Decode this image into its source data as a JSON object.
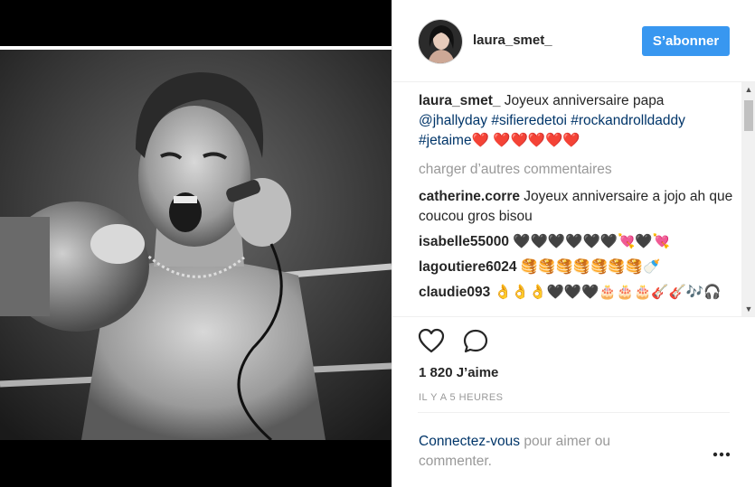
{
  "post": {
    "username": "laura_smet_",
    "follow_label": "S’abonner",
    "caption": {
      "user": "laura_smet_",
      "text": " Joyeux anniversaire papa ",
      "mention": "@jhallyday",
      "tags": [
        "#sifieredetoi",
        "#rockandrolldaddy",
        "#jetaime"
      ],
      "hearts": "❤️ ❤️❤️❤️❤️❤️"
    },
    "load_more_label": "charger d’autres commentaires",
    "comments": [
      {
        "user": "catherine.corre",
        "text": " Joyeux anniversaire a jojo ah que coucou gros bisou"
      },
      {
        "user": "isabelle55000",
        "text": " 🖤🖤🖤🖤🖤🖤💘🖤💘"
      },
      {
        "user": "lagoutiere6024",
        "text": " 🥞🥞🥞🥞🥞🥞🥞🍼"
      },
      {
        "user": "claudie093",
        "text": " 👌👌👌🖤🖤🖤🎂🎂🎂🎸🎸🎶🎧"
      }
    ],
    "likes_label": "1 820 J’aime",
    "time_label": "IL Y A 5 HEURES",
    "login_link": "Connectez-vous",
    "login_text": " pour aimer ou commenter."
  },
  "icons": {
    "like": "heart-outline-icon",
    "comment": "speech-bubble-icon",
    "more": "ellipsis-icon"
  },
  "colors": {
    "accent": "#3897f0",
    "link": "#003569",
    "muted": "#999999",
    "heart": "#e0152b"
  }
}
